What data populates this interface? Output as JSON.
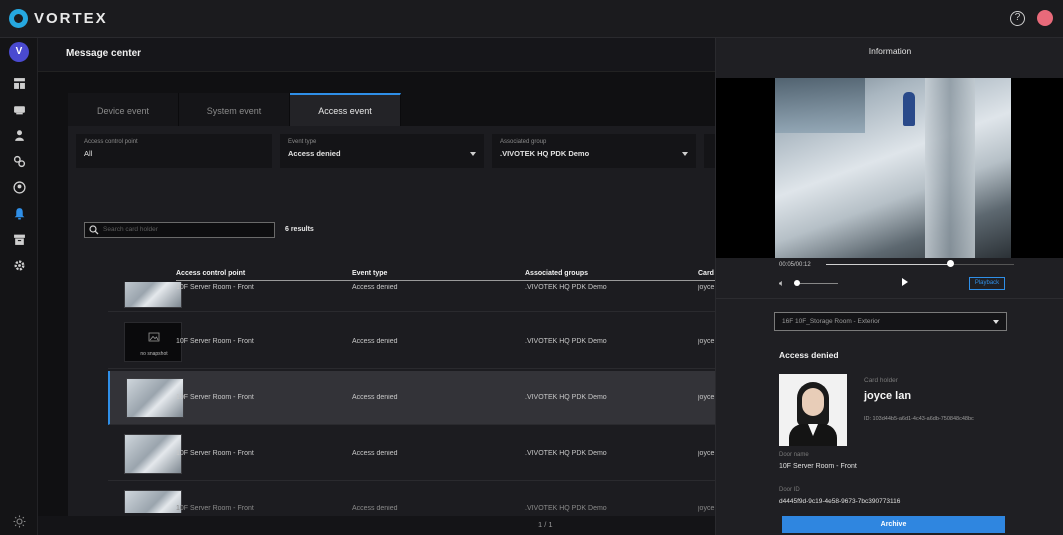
{
  "app": {
    "brand": "VORTEX",
    "help_symbol": "?"
  },
  "sidebar": {
    "avatar_initial": "V",
    "items": [
      {
        "icon": "dashboard-icon"
      },
      {
        "icon": "devices-icon"
      },
      {
        "icon": "people-icon"
      },
      {
        "icon": "access-icon"
      },
      {
        "icon": "user-circle-icon"
      },
      {
        "icon": "bell-icon",
        "active": true
      },
      {
        "icon": "archive-icon"
      },
      {
        "icon": "gear-icon"
      }
    ],
    "bottom_icon": "sun-icon"
  },
  "header": {
    "title": "Message center"
  },
  "tabs": [
    {
      "label": "Device event"
    },
    {
      "label": "System event"
    },
    {
      "label": "Access event",
      "active": true
    }
  ],
  "filters": {
    "access_point": {
      "label": "Access control point",
      "value": "All"
    },
    "event_type": {
      "label": "Event type",
      "value": "Access denied"
    },
    "group": {
      "label": "Associated group",
      "value": ".VIVOTEK HQ PDK Demo"
    }
  },
  "search": {
    "placeholder": "Search card holder"
  },
  "results": "6 results",
  "table": {
    "columns": [
      "Access control point",
      "Event type",
      "Associated groups",
      "Card"
    ],
    "rows": [
      {
        "point": "10F Server Room - Front",
        "event": "Access denied",
        "group": ".VIVOTEK HQ PDK Demo",
        "card": "joyce",
        "snapshot": true
      },
      {
        "point": "10F Server Room - Front",
        "event": "Access denied",
        "group": ".VIVOTEK HQ PDK Demo",
        "card": "joyce",
        "snapshot": false,
        "no_snapshot_text": "no snapshot"
      },
      {
        "point": "10F Server Room - Front",
        "event": "Access denied",
        "group": ".VIVOTEK HQ PDK Demo",
        "card": "joyce",
        "snapshot": true,
        "selected": true
      },
      {
        "point": "10F Server Room - Front",
        "event": "Access denied",
        "group": ".VIVOTEK HQ PDK Demo",
        "card": "joyce",
        "snapshot": true
      },
      {
        "point": "10F Server Room - Front",
        "event": "Access denied",
        "group": ".VIVOTEK HQ PDK Demo",
        "card": "joyce",
        "snapshot": true
      }
    ]
  },
  "pager": {
    "text": "1 / 1"
  },
  "info": {
    "title": "Information",
    "video": {
      "time": "00:05/00:12",
      "progress": 0.66,
      "volume": 0.0,
      "playback_label": "Playback"
    },
    "camera": "16F 10F_Storage Room - Exterior",
    "event_title": "Access denied",
    "card_holder_label": "Card holder",
    "card_holder": "joyce lan",
    "card_id": "ID: 103d44b5-a6d1-4c43-a6db-750848c48bc",
    "door_name_label": "Door name",
    "door_name": "10F Server Room - Front",
    "door_id_label": "Door ID",
    "door_id": "d4445f9d-9c19-4e58-9673-7bc390773116",
    "archive_label": "Archive"
  },
  "colors": {
    "accent": "#2f8fe8",
    "brand": "#26a8e0",
    "avatar": "#4a4ad0"
  }
}
